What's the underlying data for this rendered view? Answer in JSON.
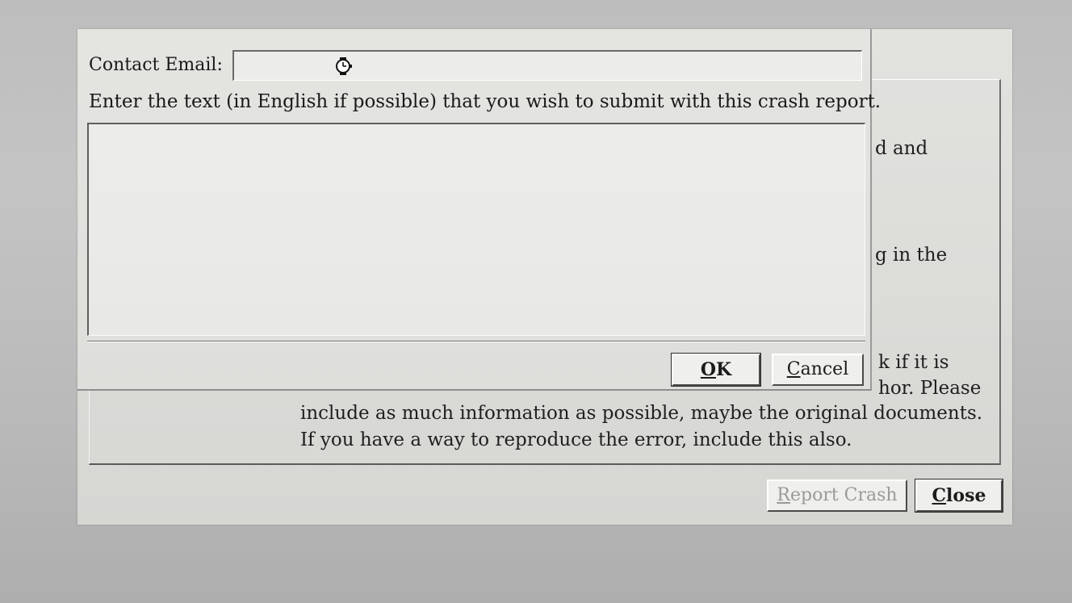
{
  "dialog": {
    "background_text": {
      "line1": "d and",
      "line2": "g in the",
      "line3": "k if it is",
      "line4": "hor. Please",
      "line5": "include as much information as possible, maybe the original documents.",
      "line6": "If you have a way to reproduce the error, include this also."
    },
    "buttons": {
      "report_crash": "Report Crash",
      "close": "Close"
    }
  },
  "popup": {
    "email_label": "Contact Email:",
    "email_value": "",
    "instruction": "Enter the text (in English if possible) that you wish to submit with this crash report.",
    "comment_value": "",
    "buttons": {
      "ok": "OK",
      "cancel": "Cancel"
    }
  },
  "icons": {
    "cursor": "busy-watch-cursor-icon"
  },
  "colors": {
    "dialog_bg": "#dcdcd9",
    "desktop_bg": "#bdbdbd",
    "disabled_text": "#9a9a9a"
  }
}
